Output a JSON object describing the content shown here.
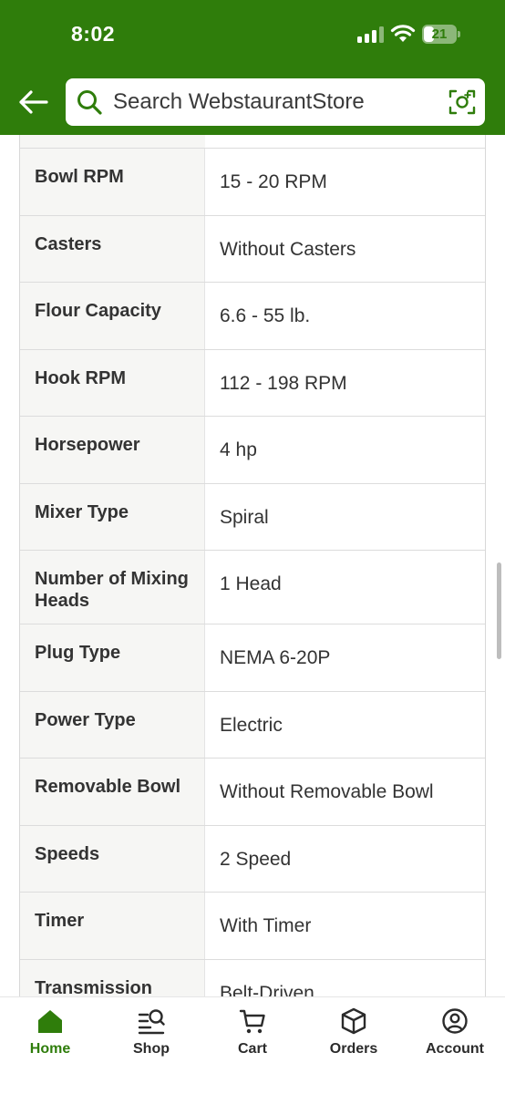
{
  "status_bar": {
    "time": "8:02",
    "battery_level": "21"
  },
  "search": {
    "placeholder": "Search WebstaurantStore"
  },
  "specs": [
    {
      "label": "Bowl RPM",
      "value": "15 - 20 RPM"
    },
    {
      "label": "Casters",
      "value": "Without Casters"
    },
    {
      "label": "Flour Capacity",
      "value": "6.6 - 55 lb."
    },
    {
      "label": "Hook RPM",
      "value": "112 - 198 RPM"
    },
    {
      "label": "Horsepower",
      "value": "4 hp"
    },
    {
      "label": "Mixer Type",
      "value": "Spiral"
    },
    {
      "label": "Number of Mixing Heads",
      "value": "1 Head"
    },
    {
      "label": "Plug Type",
      "value": "NEMA 6-20P"
    },
    {
      "label": "Power Type",
      "value": "Electric"
    },
    {
      "label": "Removable Bowl",
      "value": "Without Removable Bowl"
    },
    {
      "label": "Speeds",
      "value": "2 Speed"
    },
    {
      "label": "Timer",
      "value": "With Timer"
    },
    {
      "label": "Transmission",
      "value": "Belt-Driven"
    }
  ],
  "tabs": [
    {
      "label": "Home",
      "icon": "home-icon",
      "active": true
    },
    {
      "label": "Shop",
      "icon": "shop-search-icon",
      "active": false
    },
    {
      "label": "Cart",
      "icon": "cart-icon",
      "active": false
    },
    {
      "label": "Orders",
      "icon": "orders-box-icon",
      "active": false
    },
    {
      "label": "Account",
      "icon": "account-icon",
      "active": false
    }
  ],
  "colors": {
    "brand_green": "#2f7d0b",
    "label_bg": "#f6f6f4",
    "text": "#333333"
  }
}
